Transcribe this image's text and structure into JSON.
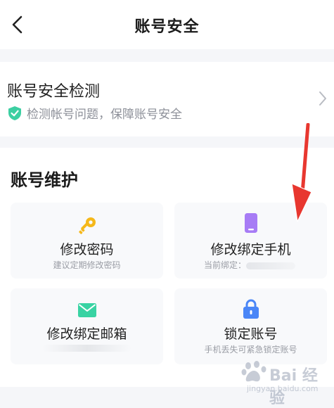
{
  "header": {
    "title": "账号安全",
    "back_icon": "chevron-left-icon"
  },
  "security_check": {
    "title": "账号安全检测",
    "subtitle": "检测帐号问题，保障账号安全",
    "icon": "shield-check-icon",
    "chevron": "chevron-right-icon",
    "icon_color": "#3ccfa2"
  },
  "maintenance": {
    "title": "账号维护",
    "tiles": [
      {
        "label": "修改密码",
        "sub": "建议定期修改密码",
        "icon": "key-icon",
        "icon_color": "#f5b81a"
      },
      {
        "label": "修改绑定手机",
        "sub": "当前绑定：",
        "icon": "phone-icon",
        "icon_color": "#a77cf5"
      },
      {
        "label": "修改绑定邮箱",
        "sub": "",
        "icon": "mail-icon",
        "icon_color": "#39d3a3"
      },
      {
        "label": "锁定账号",
        "sub": "手机丢失可紧急锁定账号",
        "icon": "lock-icon",
        "icon_color": "#4a86f7"
      }
    ]
  },
  "annotation": {
    "arrow_color": "#e8372f"
  },
  "watermark": {
    "text": "Bai 经验",
    "url": "jingyan.baidu.com"
  }
}
